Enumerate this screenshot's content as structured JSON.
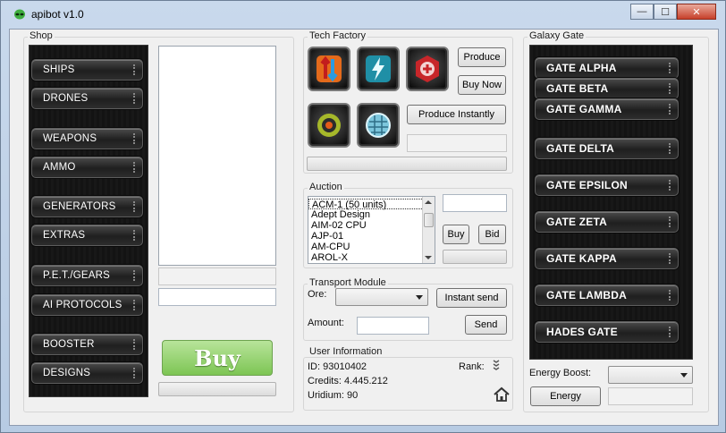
{
  "window": {
    "title": "apibot v1.0",
    "controls": {
      "minimize": "—",
      "maximize": "☐",
      "close": "✕"
    }
  },
  "shop": {
    "label": "Shop",
    "items": [
      "SHIPS",
      "DRONES",
      "WEAPONS",
      "AMMO",
      "GENERATORS",
      "EXTRAS",
      "P.E.T./GEARS",
      "AI PROTOCOLS",
      "BOOSTER",
      "DESIGNS"
    ],
    "buy_label": "Buy"
  },
  "tech_factory": {
    "label": "Tech Factory",
    "icons": [
      "energy-leech-icon",
      "lightning-icon",
      "heal-hexagon-icon",
      "gear-target-icon",
      "shield-grid-icon"
    ],
    "produce_label": "Produce",
    "buy_now_label": "Buy Now",
    "produce_instantly_label": "Produce Instantly"
  },
  "auction": {
    "label": "Auction",
    "items": [
      "ACM-1 (50 units)",
      "Adept Design",
      "AIM-02 CPU",
      "AJP-01",
      "AM-CPU",
      "AROL-X"
    ],
    "buy_label": "Buy",
    "bid_label": "Bid"
  },
  "transport": {
    "label": "Transport Module",
    "ore_label": "Ore:",
    "amount_label": "Amount:",
    "instant_send_label": "Instant send",
    "send_label": "Send"
  },
  "user_info": {
    "label": "User Information",
    "id_text": "ID:  93010402",
    "credits_text": "Credits:  4.445.212",
    "uridium_text": "Uridium: 90",
    "rank_label": "Rank:"
  },
  "galaxy_gate": {
    "label": "Galaxy Gate",
    "gates": [
      "GATE ALPHA",
      "GATE BETA",
      "GATE GAMMA",
      "GATE DELTA",
      "GATE EPSILON",
      "GATE ZETA",
      "GATE KAPPA",
      "GATE LAMBDA",
      "HADES GATE"
    ],
    "energy_boost_label": "Energy Boost:",
    "energy_label": "Energy"
  }
}
